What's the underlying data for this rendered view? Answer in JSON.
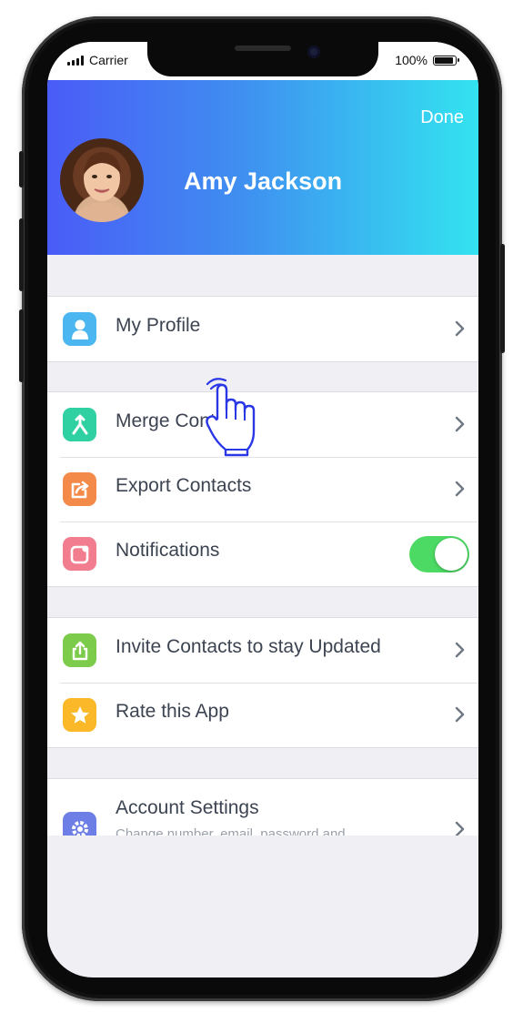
{
  "status_bar": {
    "carrier": "Carrier",
    "battery": "100%"
  },
  "header": {
    "done_label": "Done",
    "user_name": "Amy Jackson"
  },
  "menu": {
    "my_profile": "My Profile",
    "merge_contacts": "Merge Contacts",
    "export_contacts": "Export Contacts",
    "notifications": "Notifications",
    "invite_contacts": "Invite Contacts to stay Updated",
    "rate_app": "Rate this App",
    "account_settings": "Account Settings",
    "account_settings_sub": "Change number, email, password and..."
  },
  "notifications_enabled": true,
  "colors": {
    "gradient_start": "#4a5cf7",
    "gradient_end": "#33e3f0",
    "profile_icon": "#4bb6f0",
    "merge_icon": "#2fd1a3",
    "export_icon": "#f48a4a",
    "notifications_icon": "#f27d8e",
    "invite_icon": "#7dcb4a",
    "rate_icon": "#fbb92a",
    "settings_icon": "#6d7fe6",
    "toggle_on": "#4cd964"
  },
  "icons": {
    "profile": "person-icon",
    "merge": "merge-icon",
    "export": "export-icon",
    "notifications": "notification-icon",
    "invite": "share-icon",
    "rate": "star-icon",
    "settings": "gear-icon",
    "chevron": "chevron-right-icon",
    "gesture": "tap-hand-icon"
  }
}
